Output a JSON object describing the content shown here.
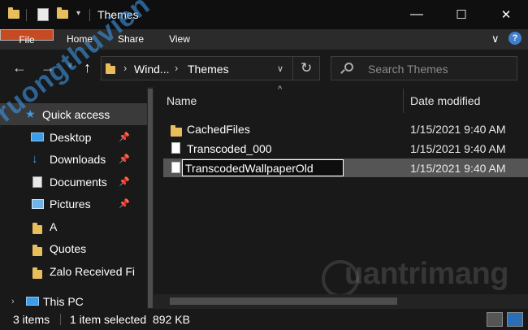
{
  "window": {
    "title": "Themes",
    "controls": {
      "minimize": "—",
      "maximize": "☐",
      "close": "✕"
    }
  },
  "ribbon": {
    "tabs": [
      "File",
      "Home",
      "Share",
      "View"
    ],
    "file_color": "#c64b23"
  },
  "address": {
    "crumbs": [
      "Wind...",
      "Themes"
    ],
    "refresh": "↻",
    "search_placeholder": "Search Themes"
  },
  "nav": {
    "items": [
      {
        "label": "Quick access",
        "icon": "star-icon",
        "pinned": false
      },
      {
        "label": "Desktop",
        "icon": "desktop-icon",
        "pinned": true
      },
      {
        "label": "Downloads",
        "icon": "download-icon",
        "pinned": true
      },
      {
        "label": "Documents",
        "icon": "documents-icon",
        "pinned": true
      },
      {
        "label": "Pictures",
        "icon": "pictures-icon",
        "pinned": true
      },
      {
        "label": "A",
        "icon": "folder-icon",
        "pinned": false
      },
      {
        "label": "Quotes",
        "icon": "folder-icon",
        "pinned": false
      },
      {
        "label": "Zalo Received Fi",
        "icon": "folder-icon",
        "pinned": false
      },
      {
        "label": "This PC",
        "icon": "computer-icon",
        "pinned": false
      }
    ]
  },
  "content": {
    "columns": {
      "name": "Name",
      "date": "Date modified"
    },
    "rows": [
      {
        "name": "CachedFiles",
        "date": "1/15/2021 9:40 AM",
        "type": "folder"
      },
      {
        "name": "Transcoded_000",
        "date": "1/15/2021 9:40 AM",
        "type": "file"
      },
      {
        "name": "TranscodedWallpaperOld",
        "date": "1/15/2021 9:40 AM",
        "type": "file",
        "renaming": true
      }
    ]
  },
  "status": {
    "items_count": "3 items",
    "selected": "1 item selected",
    "size": "892 KB"
  },
  "watermarks": {
    "left": "Truongthuvien",
    "right": "uantrimang"
  }
}
